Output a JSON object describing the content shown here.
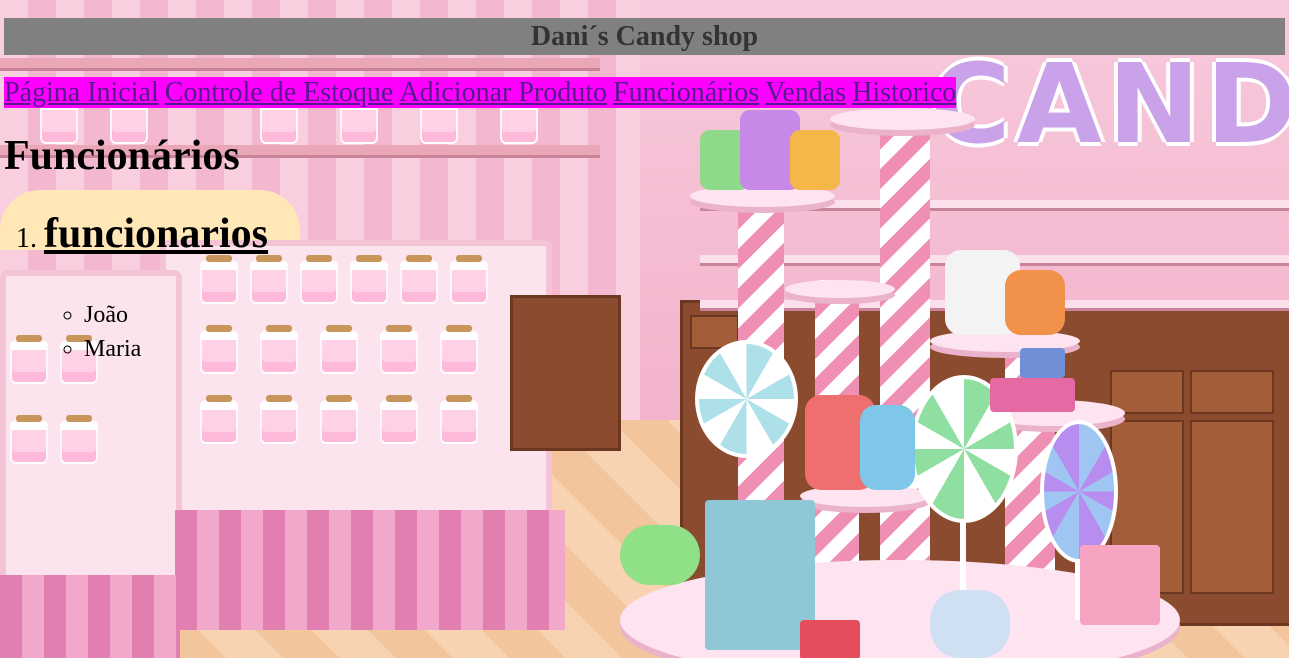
{
  "header": {
    "title": "Dani´s Candy shop"
  },
  "nav": {
    "items": [
      {
        "label": "Página Inicial"
      },
      {
        "label": "Controle de Estoque"
      },
      {
        "label": "Adicionar Produto"
      },
      {
        "label": "Funcionários"
      },
      {
        "label": "Vendas"
      },
      {
        "label": "Historico"
      }
    ]
  },
  "main": {
    "page_title": "Funcionários",
    "section": {
      "number": "1.",
      "label": "funcionarios",
      "employees": [
        "João",
        "Maria"
      ]
    }
  },
  "background": {
    "sign_text": "CANDY",
    "description_colors": {
      "header_bg": "#808080",
      "nav_bg": "#ff00ff",
      "link": "#551a8b"
    }
  }
}
